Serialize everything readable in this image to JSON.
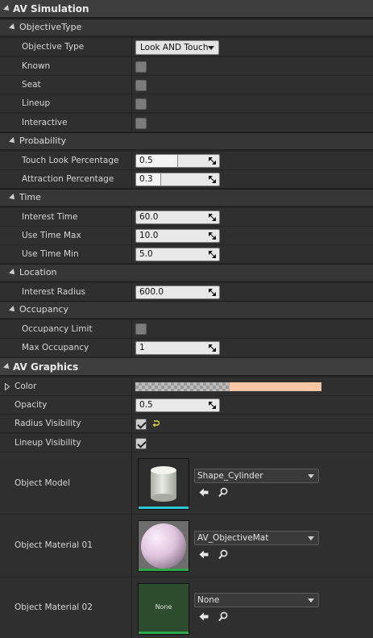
{
  "av_simulation": {
    "title": "AV Simulation",
    "objective_type": {
      "header": "ObjectiveType",
      "objective_type_label": "Objective Type",
      "objective_type_value": "Look AND Touch",
      "known_label": "Known",
      "known_checked": false,
      "seat_label": "Seat",
      "seat_checked": false,
      "lineup_label": "Lineup",
      "lineup_checked": false,
      "interactive_label": "Interactive",
      "interactive_checked": false
    },
    "probability": {
      "header": "Probability",
      "touch_look_label": "Touch Look Percentage",
      "touch_look_value": "0.5",
      "attraction_label": "Attraction Percentage",
      "attraction_value": "0.3"
    },
    "time": {
      "header": "Time",
      "interest_time_label": "Interest Time",
      "interest_time_value": "60.0",
      "use_time_max_label": "Use Time Max",
      "use_time_max_value": "10.0",
      "use_time_min_label": "Use Time Min",
      "use_time_min_value": "5.0"
    },
    "location": {
      "header": "Location",
      "interest_radius_label": "Interest Radius",
      "interest_radius_value": "600.0"
    },
    "occupancy": {
      "header": "Occupancy",
      "occupancy_limit_label": "Occupancy Limit",
      "occupancy_limit_checked": false,
      "max_occupancy_label": "Max Occupancy",
      "max_occupancy_value": "1"
    }
  },
  "av_graphics": {
    "title": "AV Graphics",
    "color_label": "Color",
    "color_value": "#ffc6a6",
    "opacity_label": "Opacity",
    "opacity_value": "0.5",
    "radius_visibility_label": "Radius Visibility",
    "radius_visibility_checked": true,
    "lineup_visibility_label": "Lineup Visibility",
    "lineup_visibility_checked": true,
    "object_model_label": "Object Model",
    "object_model_asset": "Shape_Cylinder",
    "object_material_01_label": "Object Material 01",
    "object_material_01_asset": "AV_ObjectiveMat",
    "object_material_02_label": "Object Material 02",
    "object_material_02_asset": "None",
    "object_material_02_thumb_text": "None"
  },
  "colors": {
    "model_bar": "#2fc6d6",
    "material_bar": "#2fa84a",
    "thumb_none_bg": "#2e4d2e",
    "slider_fill_touch_look": 0.5,
    "slider_fill_attraction": 0.3
  }
}
